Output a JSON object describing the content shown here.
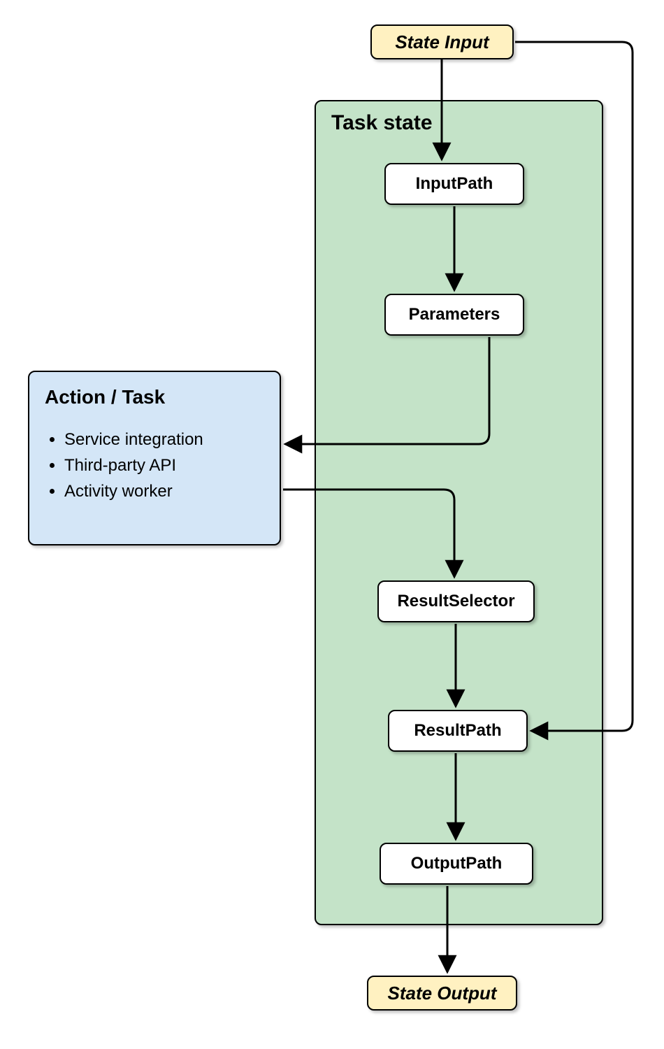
{
  "io": {
    "input_label": "State Input",
    "output_label": "State Output"
  },
  "task": {
    "title": "Task state",
    "steps": {
      "input_path": "InputPath",
      "parameters": "Parameters",
      "result_selector": "ResultSelector",
      "result_path": "ResultPath",
      "output_path": "OutputPath"
    }
  },
  "action": {
    "title": "Action / Task",
    "items": [
      "Service integration",
      "Third-party API",
      "Activity worker"
    ]
  },
  "colors": {
    "io_bg": "#fff1c1",
    "task_bg": "#c4e3c8",
    "action_bg": "#d4e6f7",
    "step_bg": "#ffffff",
    "border": "#000000"
  }
}
